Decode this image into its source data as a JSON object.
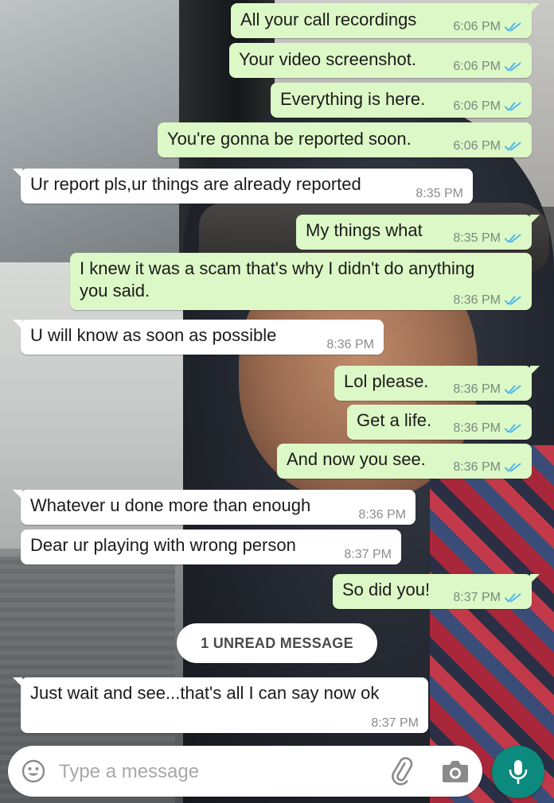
{
  "colors": {
    "outgoing_bubble": "#dcf8c6",
    "incoming_bubble": "#ffffff",
    "read_ticks": "#4fb6ec",
    "mic_button": "#0b8a7d"
  },
  "messages": [
    {
      "direction": "outgoing",
      "text": "All your call recordings",
      "time": "6:06 PM",
      "status": "read"
    },
    {
      "direction": "outgoing",
      "text": "Your video screenshot.",
      "time": "6:06 PM",
      "status": "read"
    },
    {
      "direction": "outgoing",
      "text": "Everything is here.",
      "time": "6:06 PM",
      "status": "read"
    },
    {
      "direction": "outgoing",
      "text": "You're gonna be reported soon.",
      "time": "6:06 PM",
      "status": "read"
    },
    {
      "direction": "incoming",
      "text": "Ur report pls,ur things are already reported",
      "time": "8:35 PM"
    },
    {
      "direction": "outgoing",
      "text": "My things what",
      "time": "8:35 PM",
      "status": "read"
    },
    {
      "direction": "outgoing",
      "text_lines": [
        "I knew it was a scam that's why I didn't do anything",
        "you said."
      ],
      "time": "8:36 PM",
      "status": "read"
    },
    {
      "direction": "incoming",
      "text": "U will know as soon as possible",
      "time": "8:36 PM"
    },
    {
      "direction": "outgoing",
      "text": "Lol please.",
      "time": "8:36 PM",
      "status": "read"
    },
    {
      "direction": "outgoing",
      "text": "Get a life.",
      "time": "8:36 PM",
      "status": "read"
    },
    {
      "direction": "outgoing",
      "text": "And now you see.",
      "time": "8:36 PM",
      "status": "read"
    },
    {
      "direction": "incoming",
      "text": "Whatever u done more than enough",
      "time": "8:36 PM"
    },
    {
      "direction": "incoming",
      "text": "Dear ur playing with wrong person",
      "time": "8:37 PM"
    },
    {
      "direction": "outgoing",
      "text": "So did you!",
      "time": "8:37 PM",
      "status": "read"
    },
    {
      "direction": "incoming",
      "text": "Just wait and see...that's all I can say now ok",
      "time": "8:37 PM"
    }
  ],
  "unread_banner": "1 UNREAD MESSAGE",
  "composer": {
    "placeholder": "Type a message",
    "value": "",
    "emoji_icon": "emoji-icon",
    "attach_icon": "paperclip-icon",
    "camera_icon": "camera-icon",
    "mic_icon": "mic-icon"
  }
}
